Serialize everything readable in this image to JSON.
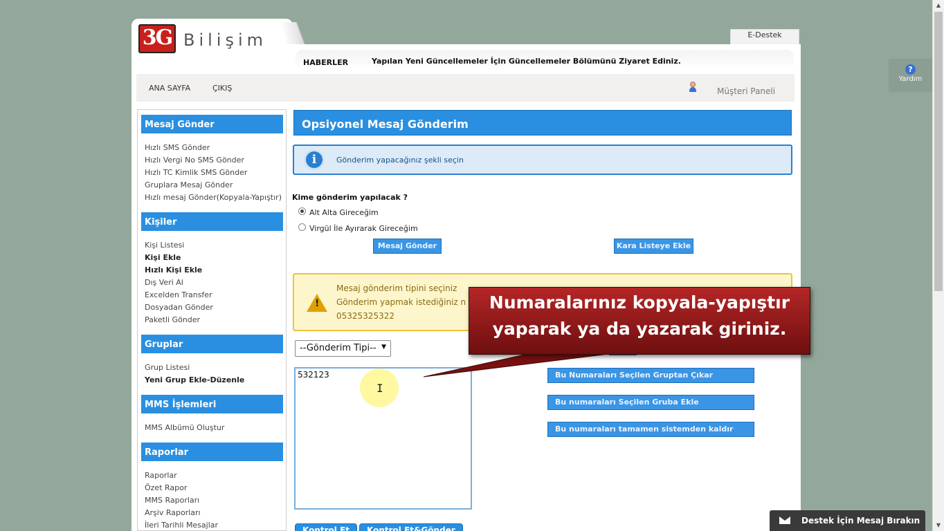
{
  "brand": {
    "logo_mark": "3G",
    "logo_text": "Bilişim",
    "accent": "#2a8fe0",
    "logo_color": "#c8201d"
  },
  "edestek": "E-Destek",
  "news": {
    "label": "HABERLER",
    "text": "Yapılan Yeni Güncellemeler İçin Güncellemeler Bölümünü Ziyaret Ediniz."
  },
  "nav": {
    "home": "ANA SAYFA",
    "logout": "ÇIKIŞ",
    "panel": "Müşteri Paneli",
    "user_icon": "user-icon"
  },
  "help": {
    "label": "Yardım",
    "icon": "?"
  },
  "sidebar": {
    "sections": [
      {
        "title": "Mesaj Gönder",
        "items": [
          "Hızlı SMS Gönder",
          "Hızlı Vergi No SMS Gönder",
          "Hızlı TC Kimlik SMS Gönder",
          "Gruplara Mesaj Gönder",
          "Hızlı mesaj Gönder(Kopyala-Yapıştır)"
        ]
      },
      {
        "title": "Kişiler",
        "items": [
          "Kişi Listesi",
          "Kişi Ekle",
          "Hızlı Kişi Ekle",
          "Dış Veri Al",
          "Excelden Transfer",
          "Dosyadan Gönder",
          "Paketli Gönder"
        ]
      },
      {
        "title": "Gruplar",
        "items": [
          "Grup Listesi",
          "Yeni Grup Ekle-Düzenle"
        ]
      },
      {
        "title": "MMS İşlemleri",
        "items": [
          "MMS Albümü Oluştur"
        ]
      },
      {
        "title": "Raporlar",
        "items": [
          "Raporlar",
          "Özet Rapor",
          "MMS Raporları",
          "Arşiv Raporları",
          "İleri Tarihli Mesajlar"
        ]
      }
    ]
  },
  "main": {
    "title": "Opsiyonel Mesaj Gönderim",
    "info": "Gönderim yapacağınız şekli seçin",
    "question": "Kime gönderim yapılacak ?",
    "radio1": "Alt Alta Gireceğim",
    "radio2": "Virgül İle Ayırarak Gireceğim",
    "btn_send": "Mesaj Gönder",
    "btn_blacklist": "Kara Listeye Ekle",
    "warn_line1": "Mesaj gönderim tipini seçiniz",
    "warn_line2": "Gönderim yapmak istediğiniz n",
    "warn_line3": "05325325322",
    "select_value": "--Gönderim Tipi--",
    "textarea_value": "532123",
    "btn_remove_group": "Bu Numaraları Seçilen Gruptan Çıkar",
    "btn_add_group": "Bu numaraları Seçilen Gruba Ekle",
    "btn_remove_system": "Bu numaraları tamamen sistemden kaldır",
    "btn_check": "Kontrol Et",
    "btn_check_send": "Kontrol Et&Gönder"
  },
  "callout": {
    "line1": "Numaralarınız kopyala-yapıştır",
    "line2": "yaparak ya da yazarak giriniz."
  },
  "support": "Destek İçin Mesaj Bırakın"
}
